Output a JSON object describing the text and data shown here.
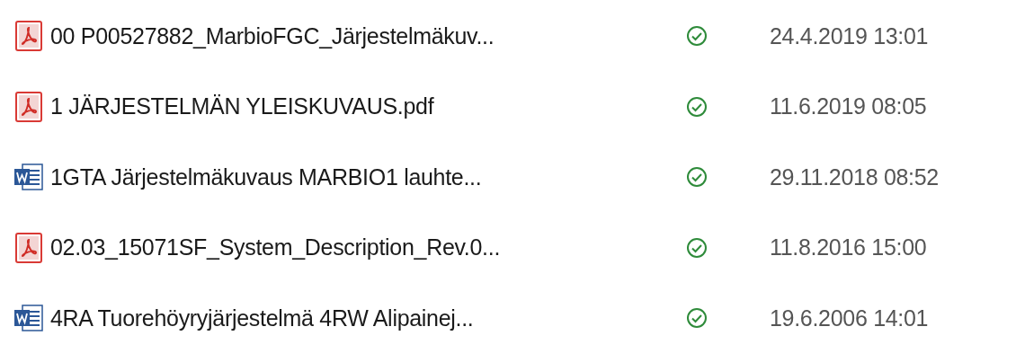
{
  "files": [
    {
      "kind": "pdf",
      "name": "00 P00527882_MarbioFGC_Järjestelmäkuv...",
      "synced": true,
      "modified": "24.4.2019 13:01"
    },
    {
      "kind": "pdf",
      "name": "1 JÄRJESTELMÄN YLEISKUVAUS.pdf",
      "synced": true,
      "modified": "11.6.2019 08:05"
    },
    {
      "kind": "word",
      "name": "1GTA Järjestelmäkuvaus MARBIO1 lauhte...",
      "synced": true,
      "modified": "29.11.2018 08:52"
    },
    {
      "kind": "pdf",
      "name": "02.03_15071SF_System_Description_Rev.0...",
      "synced": true,
      "modified": "11.8.2016 15:00"
    },
    {
      "kind": "word",
      "name": "4RA Tuorehöyryjärjestelmä 4RW Alipainej...",
      "synced": true,
      "modified": "19.6.2006 14:01"
    }
  ]
}
